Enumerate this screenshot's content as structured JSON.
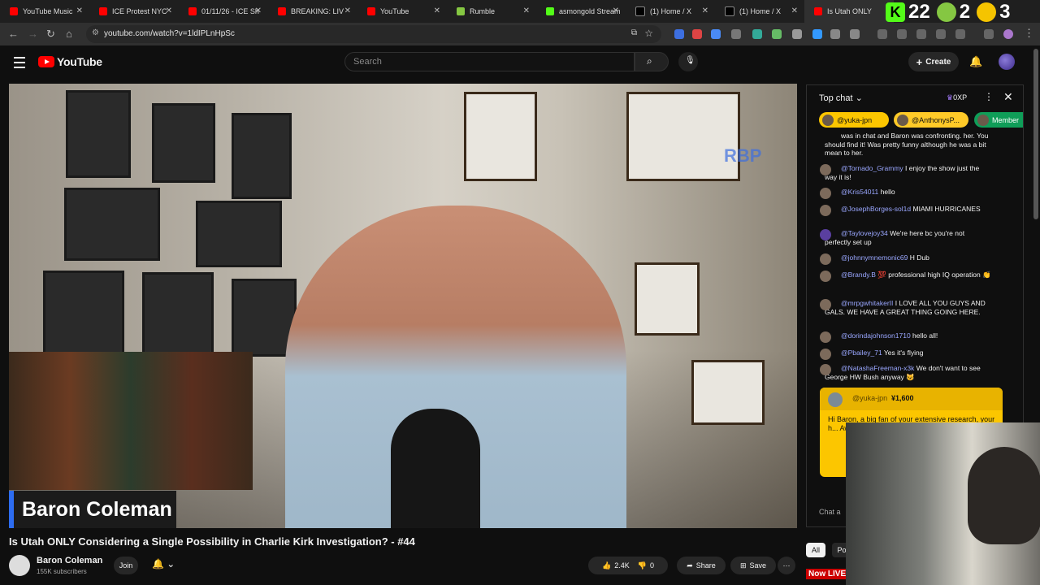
{
  "browser": {
    "tabs": [
      {
        "title": "YouTube Music",
        "color": "#ff0000"
      },
      {
        "title": "ICE Protest NYC",
        "color": "#ff0000"
      },
      {
        "title": "01/11/26 - ICE Sh",
        "color": "#ff0000"
      },
      {
        "title": "BREAKING: LIV",
        "color": "#ff0000"
      },
      {
        "title": "YouTube",
        "color": "#ff0000"
      },
      {
        "title": "Rumble",
        "color": "#85c742"
      },
      {
        "title": "asmongold Stream",
        "color": "#53fc18"
      },
      {
        "title": "(1) Home / X",
        "color": "#000000"
      },
      {
        "title": "(1) Home / X",
        "color": "#000000"
      },
      {
        "title": "Is Utah ONLY",
        "color": "#ff0000"
      }
    ],
    "url": "youtube.com/watch?v=1ldIPLnHpSc",
    "overlay_numbers": [
      "2",
      "2",
      "2",
      "3"
    ]
  },
  "header": {
    "logo": "YouTube",
    "search_placeholder": "Search",
    "create_label": "Create"
  },
  "video": {
    "name_overlay": "Baron Coleman",
    "watermark": "RBP",
    "title": "Is Utah ONLY Considering a Single Possibility in Charlie Kirk Investigation? - #44",
    "channel": "Baron Coleman",
    "subscribers": "155K subscribers",
    "join_label": "Join",
    "likes": "2.4K",
    "dislikes": "0",
    "share_label": "Share",
    "save_label": "Save"
  },
  "chat": {
    "header_label": "Top chat",
    "xp": "0XP",
    "tickers": [
      {
        "user": "@yuka-jpn",
        "color": "#fcc600"
      },
      {
        "user": "@AnthonysP...",
        "color": "#ffca28"
      },
      {
        "user": "Member",
        "color": "#0f9d58"
      }
    ],
    "messages": [
      {
        "user": "",
        "text": "was in chat and Baron was confronting. her. You should find it! Was pretty funny although he was a bit mean to her."
      },
      {
        "user": "@Tornado_Grammy",
        "text": "I enjoy the show just the way it is!"
      },
      {
        "user": "@Kris54011",
        "text": "hello"
      },
      {
        "user": "@JosephBorges-sol1d",
        "text": "MIAMI HURRICANES"
      },
      {
        "user": "@Taylovejoy34",
        "text": "We're here bc you're not perfectly set up"
      },
      {
        "user": "@johnnymnemonic69",
        "text": "H Dub"
      },
      {
        "user": "@Brandy.B",
        "text": "💯 professional high IQ operation 👏"
      },
      {
        "user": "@mrpgwhitakerII",
        "text": "I LOVE ALL YOU GUYS AND GALS. WE HAVE A GREAT THING GOING HERE."
      },
      {
        "user": "@dorindajohnson1710",
        "text": "hello all!"
      },
      {
        "user": "@Pbailey_71",
        "text": "Yes it's flying"
      },
      {
        "user": "@NatashaFreeman-x3k",
        "text": "We don't want to see George HW Bush anyway 😺"
      }
    ],
    "donation": {
      "user": "@yuka-jpn",
      "amount": "¥1,600",
      "text": "Hi Baron, a big fan of your extensive research, your h... Awai... (from..."
    },
    "input_placeholder": "Chat a"
  },
  "filters": [
    "All",
    "Po"
  ],
  "now_live": "Now LIVE:"
}
